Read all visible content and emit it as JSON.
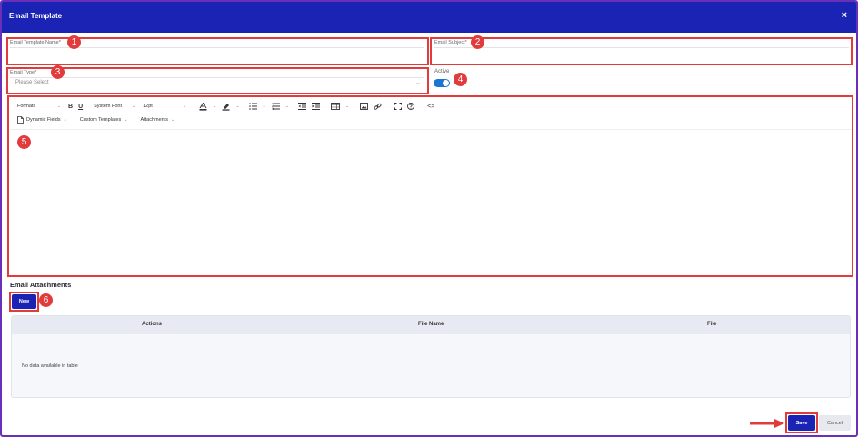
{
  "modal": {
    "title": "Email Template",
    "close_glyph": "×"
  },
  "fields": {
    "template_name": {
      "label": "Email Template Name*",
      "value": ""
    },
    "subject": {
      "label": "Email Subject*",
      "value": ""
    },
    "email_type": {
      "label": "Email Type*",
      "selected": "Please Select"
    },
    "active": {
      "label": "Active",
      "on": true
    }
  },
  "editor": {
    "toolbar_row1": {
      "formats": "Formats",
      "font_family": "System Font",
      "font_size": "12pt",
      "icons": [
        "bold-icon",
        "underline-icon",
        "text-color-icon",
        "highlight-icon",
        "bullet-list-icon",
        "numbered-list-icon",
        "outdent-icon",
        "indent-icon",
        "table-icon",
        "image-icon",
        "link-icon",
        "fullscreen-icon",
        "help-icon",
        "source-code-icon"
      ]
    },
    "toolbar_row2": {
      "dynamic_fields": "Dynamic Fields",
      "custom_templates": "Custom Templates",
      "attachments": "Attachments"
    },
    "content": ""
  },
  "attachments": {
    "title": "Email Attachments",
    "new_label": "New",
    "columns": [
      "Actions",
      "File Name",
      "File"
    ],
    "empty_text": "No data available in table"
  },
  "footer": {
    "save_label": "Save",
    "cancel_label": "Cancel"
  },
  "annotations": [
    "1",
    "2",
    "3",
    "4",
    "5",
    "6"
  ],
  "colors": {
    "header": "#1b23b4",
    "highlight": "#e23b3b",
    "toggle": "#1976d2"
  }
}
